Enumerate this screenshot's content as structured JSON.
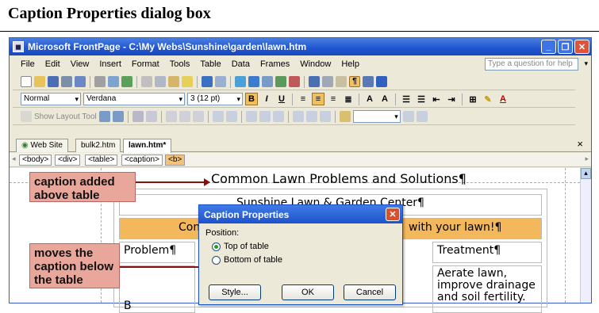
{
  "page_heading": "Caption Properties dialog box",
  "window": {
    "title": "Microsoft FrontPage - C:\\My Webs\\Sunshine\\garden\\lawn.htm"
  },
  "menu": [
    "File",
    "Edit",
    "View",
    "Insert",
    "Format",
    "Tools",
    "Table",
    "Data",
    "Frames",
    "Window",
    "Help"
  ],
  "help_placeholder": "Type a question for help",
  "format_toolbar": {
    "style": "Normal",
    "font": "Verdana",
    "size": "3 (12 pt)"
  },
  "layout_toolbar": {
    "show_layout_tool": "Show Layout Tool"
  },
  "tabs": [
    "Web Site",
    "bulk2.htm",
    "lawn.htm*"
  ],
  "tags": [
    "<body>",
    "<div>",
    "<table>",
    "<caption>",
    "<b>"
  ],
  "page": {
    "caption": "Common Lawn Problems and Solutions¶",
    "row1": "Sunshine Lawn & Garden Center¶",
    "row2_left": "Comm",
    "row2_right": "with your lawn!¶",
    "col1_header": "Problem¶",
    "col3_header": "Treatment¶",
    "treatment_text": "Aerate lawn, improve drainage and soil fertility.",
    "row4_left": "B"
  },
  "callouts": {
    "top": "caption added above table",
    "bottom": "moves the caption below the table"
  },
  "dialog": {
    "title": "Caption Properties",
    "position_label": "Position:",
    "option_top": "Top of table",
    "option_bottom": "Bottom of table",
    "style_button": "Style...",
    "ok_button": "OK",
    "cancel_button": "Cancel"
  }
}
